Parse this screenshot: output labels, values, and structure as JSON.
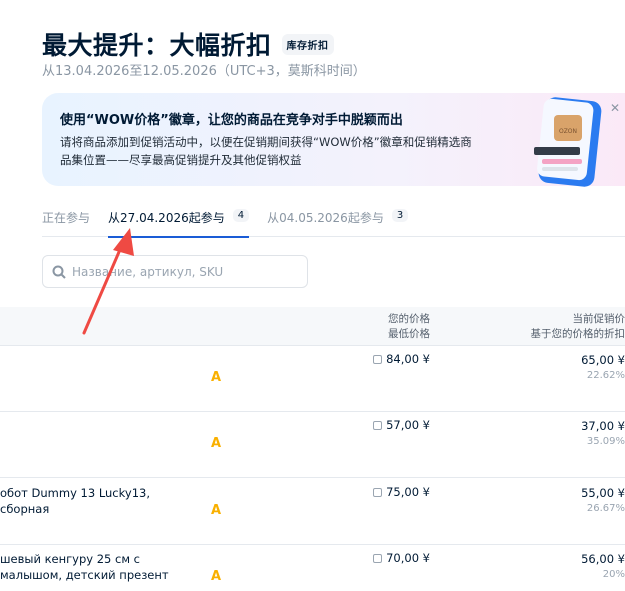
{
  "header": {
    "title": "最大提升：大幅折扣",
    "badge": "库存折扣",
    "subtitle": "从13.04.2026至12.05.2026（UTC+3，莫斯科时间）"
  },
  "banner": {
    "title": "使用“WOW价格”徽章，让您的商品在竞争对手中脱颖而出",
    "text": "请将商品添加到促销活动中，以便在促销期间获得“WOW价格”徽章和促销精选商品集位置——尽享最高促销提升及其他促销权益",
    "image_label": "OZON"
  },
  "tabs": [
    {
      "label": "正在参与",
      "count": null
    },
    {
      "label": "从27.04.2026起参与",
      "count": "4"
    },
    {
      "label": "从04.05.2026起参与",
      "count": "3"
    }
  ],
  "search": {
    "placeholder": "Название, артикул, SKU"
  },
  "table": {
    "headers": {
      "price": "您的价格",
      "price_sub": "最低价格",
      "promo": "当前促销价",
      "promo_sub": "基于您的价格的折扣"
    },
    "rows": [
      {
        "name": "",
        "grade": "A",
        "price": "84,00 ¥",
        "promo": "65,00 ¥",
        "discount": "22.62%"
      },
      {
        "name": "",
        "grade": "A",
        "price": "57,00 ¥",
        "promo": "37,00 ¥",
        "discount": "35.09%"
      },
      {
        "name": "обот Dummy 13 Lucky13, сборная",
        "grade": "A",
        "price": "75,00 ¥",
        "promo": "55,00 ¥",
        "discount": "26.67%"
      },
      {
        "name": "шевый кенгуру 25 см с малышом, детский презент",
        "grade": "A",
        "price": "70,00 ¥",
        "promo": "56,00 ¥",
        "discount": "20%"
      }
    ]
  },
  "colors": {
    "accent": "#1a5cd6",
    "grade": "#f9b000",
    "arrow": "#ef4a43"
  }
}
